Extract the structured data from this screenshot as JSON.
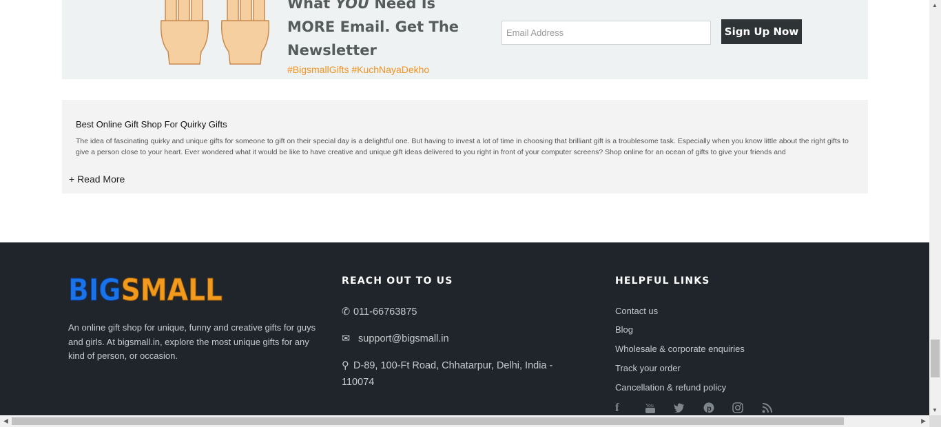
{
  "newsletter": {
    "title_prefix": "What ",
    "title_em": "YOU",
    "title_suffix": " Need Is MORE Email. Get The Newsletter",
    "hashtags": "#BigsmallGifts #KuchNayaDekho",
    "email_placeholder": "Email Address",
    "signup_label": "Sign Up Now",
    "icon": "raised-hands-icon"
  },
  "about": {
    "title": "Best Online Gift Shop For Quirky Gifts",
    "text": "The idea of fascinating quirky and unique gifts for someone to gift on their special day is a delightful one. But having to invest a lot of time in choosing that brilliant gift is a troublesome task. Especially when you know little about the right gifts to give a person close to your heart. Ever wondered what it would be like to have creative and unique gift ideas delivered to you right in front of your computer screens? Shop online for an ocean of gifts to give your friends and",
    "read_more": "+ Read More"
  },
  "footer": {
    "logo_text": "BIGSMALL",
    "logo_colors": {
      "primary": "#1a73e8",
      "secondary": "#f29a1e"
    },
    "description": "An online gift shop for unique, funny and creative gifts for guys and girls. At bigsmall.in, explore the most unique gifts for any kind of person, or occasion.",
    "reach_title": "REACH OUT TO US",
    "phone": "011-66763875",
    "email": "support@bigsmall.in",
    "address": "D-89, 100-Ft Road, Chhatarpur, Delhi, India - 110074",
    "links_title": "HELPFUL LINKS",
    "links": [
      "Contact us",
      "Blog",
      "Wholesale & corporate enquiries",
      "Track your order",
      "Cancellation & refund policy"
    ],
    "socials": [
      "facebook-icon",
      "youtube-icon",
      "twitter-icon",
      "pinterest-icon",
      "instagram-icon",
      "rss-icon"
    ]
  },
  "colors": {
    "accent_orange": "#f29221",
    "footer_bg": "#1f252b",
    "button_bg": "#2e3436"
  }
}
